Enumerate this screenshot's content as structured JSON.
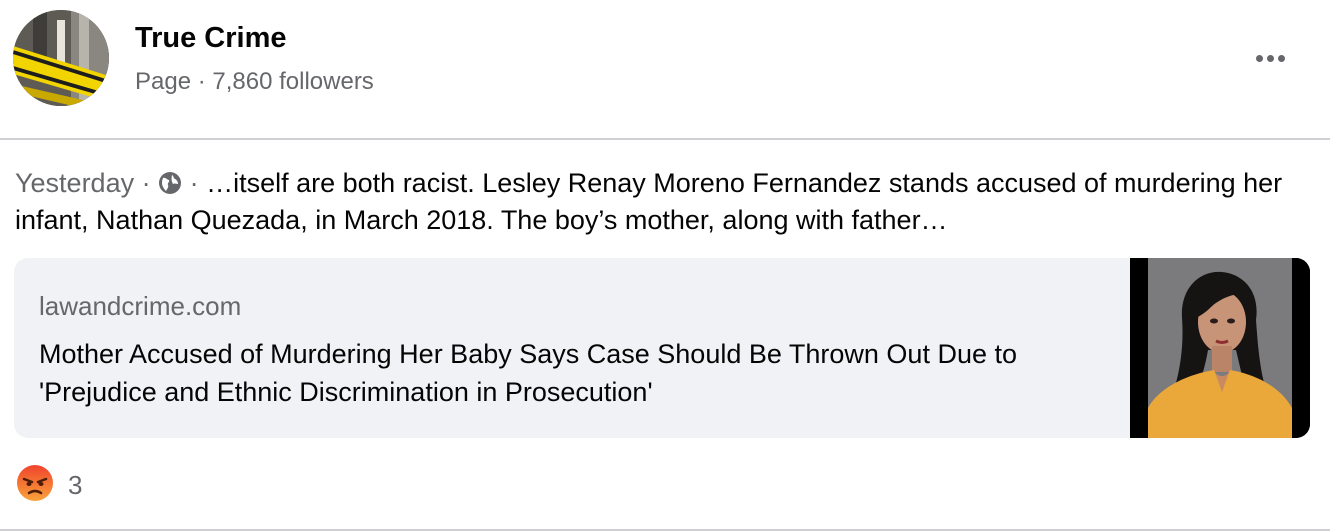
{
  "post": {
    "page_name": "True Crime",
    "page_meta": "Page · 7,860 followers",
    "timestamp": "Yesterday",
    "separator": " · ",
    "audience_icon": "globe-icon",
    "body_text": "…itself are both racist. Lesley Renay Moreno Fernandez stands accused of murdering her infant, Nathan Quezada, in March 2018. The boy’s mother, along with father…"
  },
  "link_preview": {
    "domain": "lawandcrime.com",
    "title": "Mother Accused of Murdering Her Baby Says Case Should Be Thrown Out Due to 'Prejudice and Ethnic Discrimination in Prosecution'"
  },
  "reactions": {
    "icon": "angry-reaction-icon",
    "count": "3"
  },
  "colors": {
    "secondary_text": "#65676b",
    "card_background": "#f0f2f5",
    "divider": "#ced0d4",
    "angry_reaction": "#e9710f"
  }
}
